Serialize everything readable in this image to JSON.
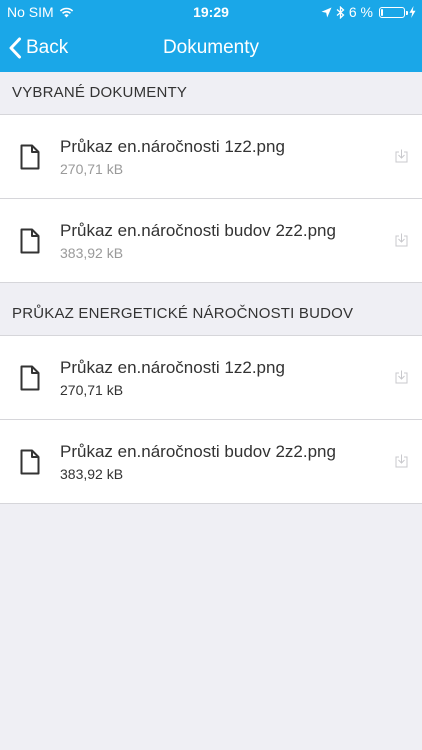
{
  "status_bar": {
    "carrier": "No SIM",
    "time": "19:29",
    "battery_percent": "6 %",
    "battery_level": 0.06
  },
  "nav": {
    "back_label": "Back",
    "title": "Dokumenty"
  },
  "sections": [
    {
      "title": "VYBRANÉ DOKUMENTY",
      "items": [
        {
          "name": "Průkaz en.náročnosti 1z2.png",
          "size": "270,71 kB"
        },
        {
          "name": "Průkaz en.náročnosti budov 2z2.png",
          "size": "383,92 kB"
        }
      ]
    },
    {
      "title": "PRŮKAZ ENERGETICKÉ NÁROČNOSTI BUDOV",
      "items": [
        {
          "name": "Průkaz en.náročnosti 1z2.png",
          "size": "270,71 kB"
        },
        {
          "name": "Průkaz en.náročnosti budov 2z2.png",
          "size": "383,92 kB"
        }
      ]
    }
  ],
  "colors": {
    "accent": "#1aa7e8",
    "background": "#efeff4",
    "size_text_first_section": "#9a9a9a",
    "size_text_second_section": "#333333"
  },
  "icons": {
    "back": "chevron-left-icon",
    "document": "document-icon",
    "download": "download-icon",
    "wifi": "wifi-icon",
    "location": "location-arrow-icon",
    "bluetooth": "bluetooth-icon",
    "battery": "battery-icon",
    "charging": "charging-bolt-icon"
  }
}
